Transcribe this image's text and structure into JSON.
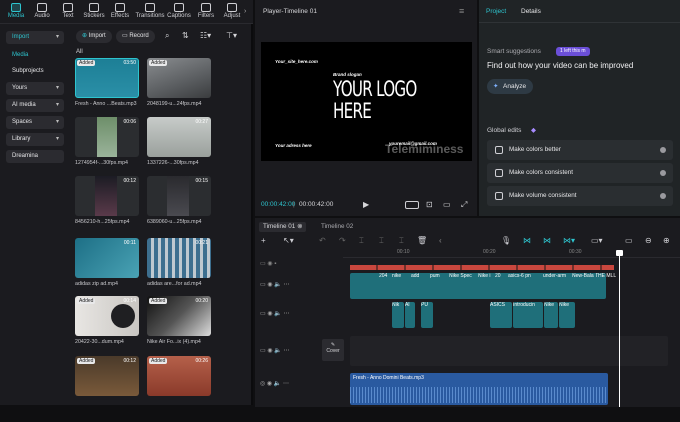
{
  "toolbar": {
    "items": [
      {
        "label": "Media",
        "icon": "media-icon",
        "active": true
      },
      {
        "label": "Audio",
        "icon": "audio-icon"
      },
      {
        "label": "Text",
        "icon": "text-icon"
      },
      {
        "label": "Stickers",
        "icon": "stickers-icon"
      },
      {
        "label": "Effects",
        "icon": "effects-icon"
      },
      {
        "label": "Transitions",
        "icon": "transitions-icon"
      },
      {
        "label": "Captions",
        "icon": "captions-icon"
      },
      {
        "label": "Filters",
        "icon": "filters-icon"
      },
      {
        "label": "Adjust",
        "icon": "adjust-icon"
      }
    ]
  },
  "sidebar": {
    "import_label": "Import",
    "items": [
      {
        "label": "Media"
      },
      {
        "label": "Subprojects"
      },
      {
        "label": "Yours"
      },
      {
        "label": "AI media"
      },
      {
        "label": "Spaces"
      },
      {
        "label": "Library"
      },
      {
        "label": "Dreamina"
      }
    ]
  },
  "media": {
    "import_button": "Import",
    "record_button": "Record",
    "filter_all": "All",
    "tiles": [
      {
        "caption": "Fresh - Anno ...Beats.mp3",
        "duration": "03:50",
        "added": "Added"
      },
      {
        "caption": "2048199-u...24fps.mp4",
        "duration": "",
        "added": "Added"
      },
      {
        "caption": "1274954f-...30fps.mp4",
        "duration": "00:06",
        "added": ""
      },
      {
        "caption": "1337226-...30fps.mp4",
        "duration": "00:27",
        "added": ""
      },
      {
        "caption": "8456210-h...25fps.mp4",
        "duration": "00:12",
        "added": ""
      },
      {
        "caption": "6389060-u...25fps.mp4",
        "duration": "00:15",
        "added": ""
      },
      {
        "caption": "adidas zip ad.mp4",
        "duration": "00:11",
        "added": ""
      },
      {
        "caption": "adidas are...for ad.mp4",
        "duration": "00:21",
        "added": ""
      },
      {
        "caption": "20422-30...dum.mp4",
        "duration": "00:14",
        "added": "Added"
      },
      {
        "caption": "Nike Air Fo...ix (4).mp4",
        "duration": "00:20",
        "added": "Added"
      },
      {
        "caption": "",
        "duration": "00:12",
        "added": "Added"
      },
      {
        "caption": "",
        "duration": "00:26",
        "added": "Added"
      }
    ]
  },
  "player": {
    "title": "Player-Timeline 01",
    "site": "Your_site_here.com",
    "slogan": "Brand slogan",
    "logo_line1": "YOUR LOGO",
    "logo_line2": "HERE",
    "address": "Your adress here",
    "email": "youremail@gmail.com",
    "watermark": "Telemiminess",
    "time_current": "00:00:42:00",
    "time_total": "00:00:42:00",
    "fit_label": "Full",
    "ratio_label": "Ratio"
  },
  "props": {
    "tab_project": "Project",
    "tab_details": "Details",
    "smart_title": "Smart suggestions",
    "smart_badge": "1 left this m",
    "smart_heading": "Find out how your video can be improved",
    "analyze_button": "Analyze",
    "global_edits": "Global edits",
    "rows": [
      {
        "label": "Make colors better"
      },
      {
        "label": "Make colors consistent"
      },
      {
        "label": "Make volume consistent"
      }
    ]
  },
  "timeline": {
    "tab1": "Timeline 01",
    "tab2": "Timeline 02",
    "ruler": [
      "00:10",
      "00:20",
      "00:30"
    ],
    "video_clips": [
      "204",
      "nike",
      "add",
      "pum",
      "Nike Spec",
      "Nike i",
      "20",
      "asics-6 pn",
      "under-arm",
      "New-Bala",
      "THE MLL"
    ],
    "overlay_clips": [
      "Nik",
      "Al",
      "PU",
      "ASICS",
      "Introducin",
      "Nike",
      "Nike"
    ],
    "cover_label": "Cover",
    "audio_clip": "Fresh - Anno Domini Beats.mp3"
  },
  "colors": {
    "accent": "#2ec5cf",
    "clip_teal": "#1f6f7a",
    "audio_blue": "#2a5aa0",
    "marker_red": "#c9473e"
  }
}
